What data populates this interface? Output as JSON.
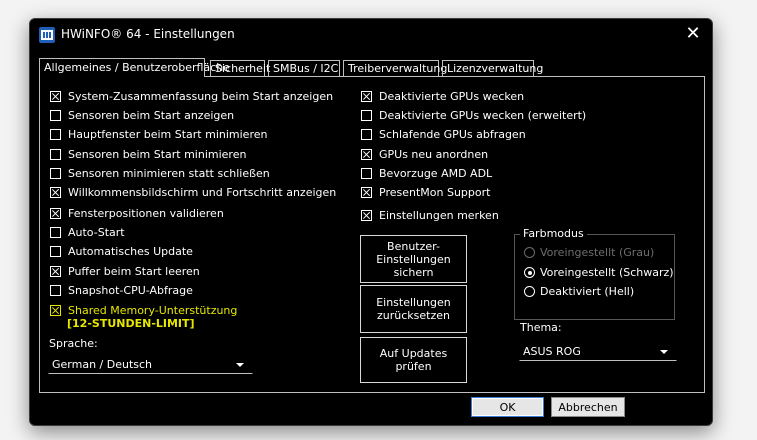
{
  "window": {
    "title": "HWiNFO® 64 - Einstellungen"
  },
  "tabs": [
    {
      "label": "Allgemeines / Benutzeroberfläche",
      "active": true
    },
    {
      "label": "Sicherheit",
      "active": false
    },
    {
      "label": "SMBus / I2C",
      "active": false
    },
    {
      "label": "Treiberverwaltung",
      "active": false
    },
    {
      "label": "Lizenzverwaltung",
      "active": false
    }
  ],
  "left_options": [
    {
      "label": "System-Zusammenfassung beim Start anzeigen",
      "checked": true
    },
    {
      "label": "Sensoren beim Start anzeigen",
      "checked": false
    },
    {
      "label": "Hauptfenster beim Start minimieren",
      "checked": false
    },
    {
      "label": "Sensoren beim Start minimieren",
      "checked": false
    },
    {
      "label": "Sensoren minimieren statt schließen",
      "checked": false
    },
    {
      "label": "Willkommensbildschirm und Fortschritt anzeigen",
      "checked": true
    },
    {
      "label": "Fensterpositionen validieren",
      "checked": true
    },
    {
      "label": "Auto-Start",
      "checked": false
    },
    {
      "label": "Automatisches Update",
      "checked": false
    },
    {
      "label": "Puffer beim Start leeren",
      "checked": true
    },
    {
      "label": "Snapshot-CPU-Abfrage",
      "checked": false
    },
    {
      "label": "Shared Memory-Unterstützung",
      "checked": true,
      "highlight": "#e6e600"
    }
  ],
  "shared_memory_limit": "[12-STUNDEN-LIMIT]",
  "right_options": [
    {
      "label": "Deaktivierte GPUs wecken",
      "checked": true
    },
    {
      "label": "Deaktivierte GPUs wecken (erweitert)",
      "checked": false
    },
    {
      "label": "Schlafende GPUs abfragen",
      "checked": false
    },
    {
      "label": "GPUs neu anordnen",
      "checked": true
    },
    {
      "label": "Bevorzuge AMD ADL",
      "checked": false
    },
    {
      "label": "PresentMon Support",
      "checked": true
    },
    {
      "label": "Einstellungen merken",
      "checked": true
    }
  ],
  "language": {
    "label": "Sprache:",
    "value": "German / Deutsch"
  },
  "buttons": {
    "save_user_settings": "Benutzer-Einstellungen sichern",
    "reset_settings": "Einstellungen zurücksetzen",
    "check_updates": "Auf Updates prüfen",
    "ok": "OK",
    "cancel": "Abbrechen"
  },
  "color_mode": {
    "title": "Farbmodus",
    "options": [
      {
        "label": "Voreingestellt (Grau)",
        "selected": false,
        "disabled": true
      },
      {
        "label": "Voreingestellt (Schwarz)",
        "selected": true,
        "disabled": false
      },
      {
        "label": "Deaktiviert (Hell)",
        "selected": false,
        "disabled": false
      }
    ]
  },
  "theme": {
    "label": "Thema:",
    "value": "ASUS ROG"
  },
  "colors": {
    "accent_yellow": "#e6e600",
    "background": "#000000",
    "text": "#ffffff"
  }
}
